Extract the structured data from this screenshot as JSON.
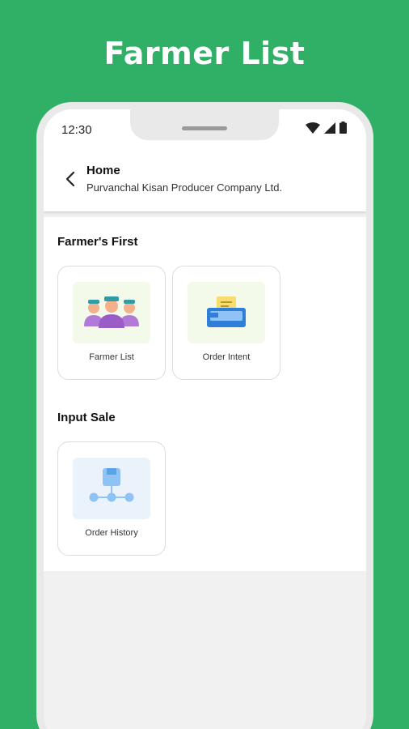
{
  "banner": {
    "title": "Farmer List"
  },
  "status_bar": {
    "time": "12:30"
  },
  "header": {
    "title": "Home",
    "subtitle": "Purvanchal Kisan Producer Company Ltd."
  },
  "sections": [
    {
      "title": "Farmer's First",
      "cards": [
        {
          "label": "Farmer List",
          "icon": "farmers-group-icon"
        },
        {
          "label": "Order Intent",
          "icon": "order-tray-icon"
        }
      ]
    },
    {
      "title": "Input Sale",
      "cards": [
        {
          "label": "Order History",
          "icon": "order-history-icon"
        }
      ]
    }
  ],
  "colors": {
    "brand_green": "#2fb066",
    "icon_bg_green": "#f3faea",
    "icon_bg_blue": "#eaf3fb"
  }
}
